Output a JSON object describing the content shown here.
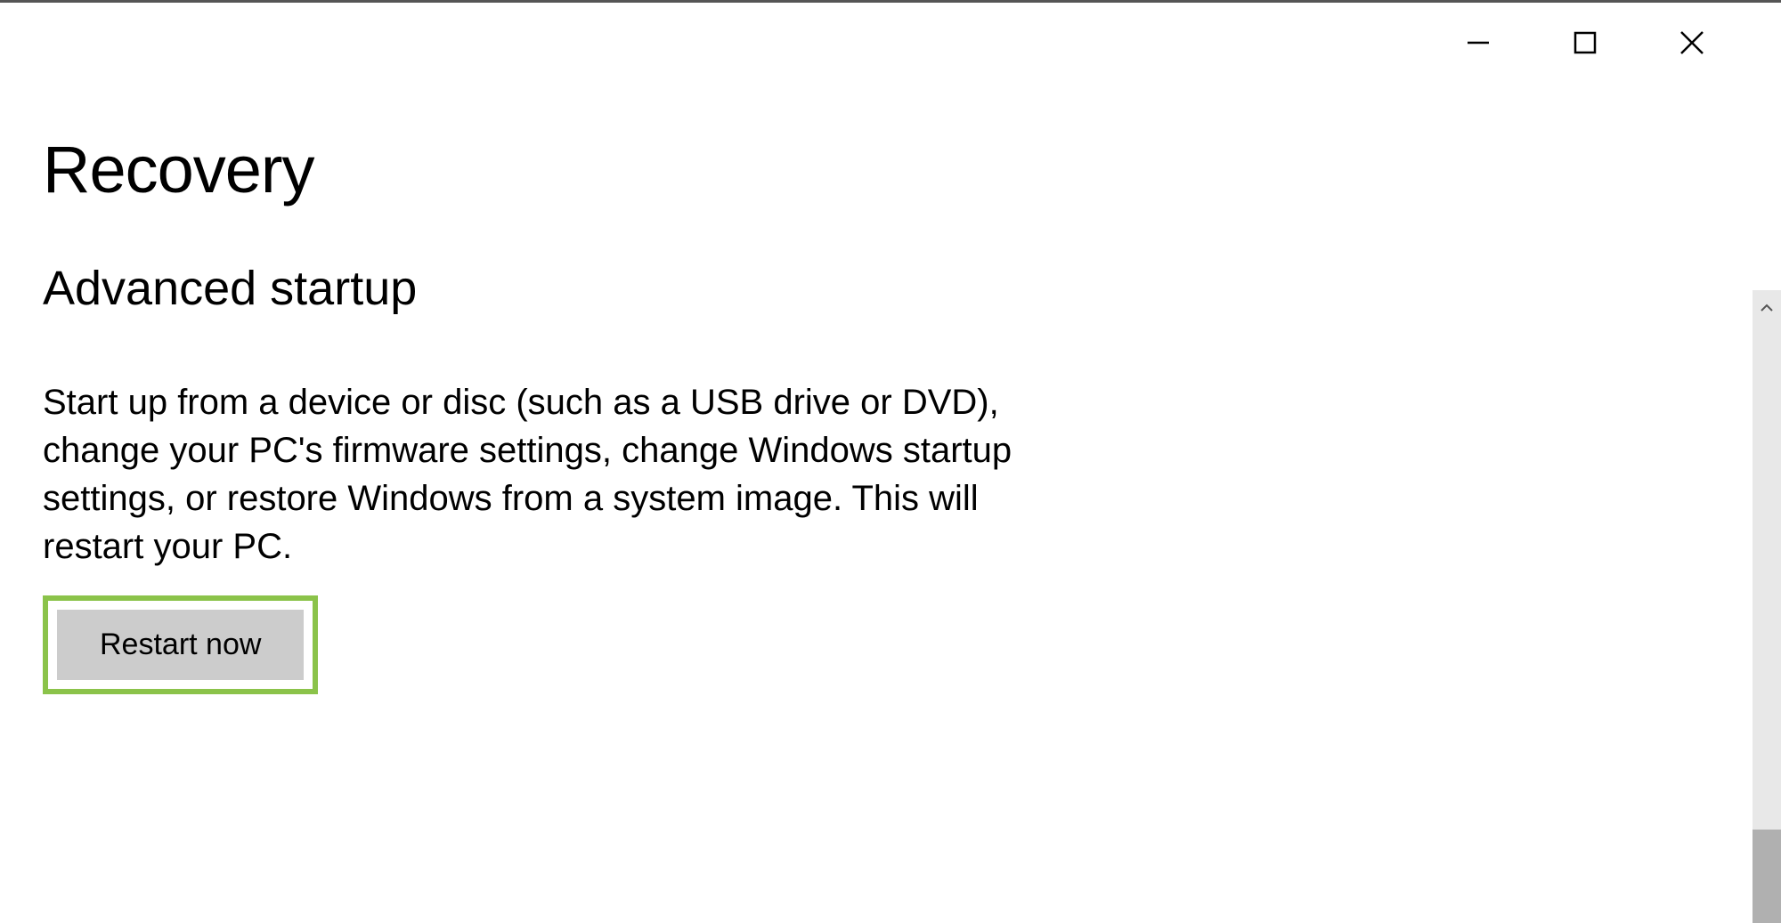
{
  "page": {
    "title": "Recovery"
  },
  "section": {
    "title": "Advanced startup",
    "description": "Start up from a device or disc (such as a USB drive or DVD), change your PC's firmware settings, change Windows startup settings, or restore Windows from a system image. This will restart your PC.",
    "button_label": "Restart now"
  },
  "highlight_color": "#8bc34a"
}
